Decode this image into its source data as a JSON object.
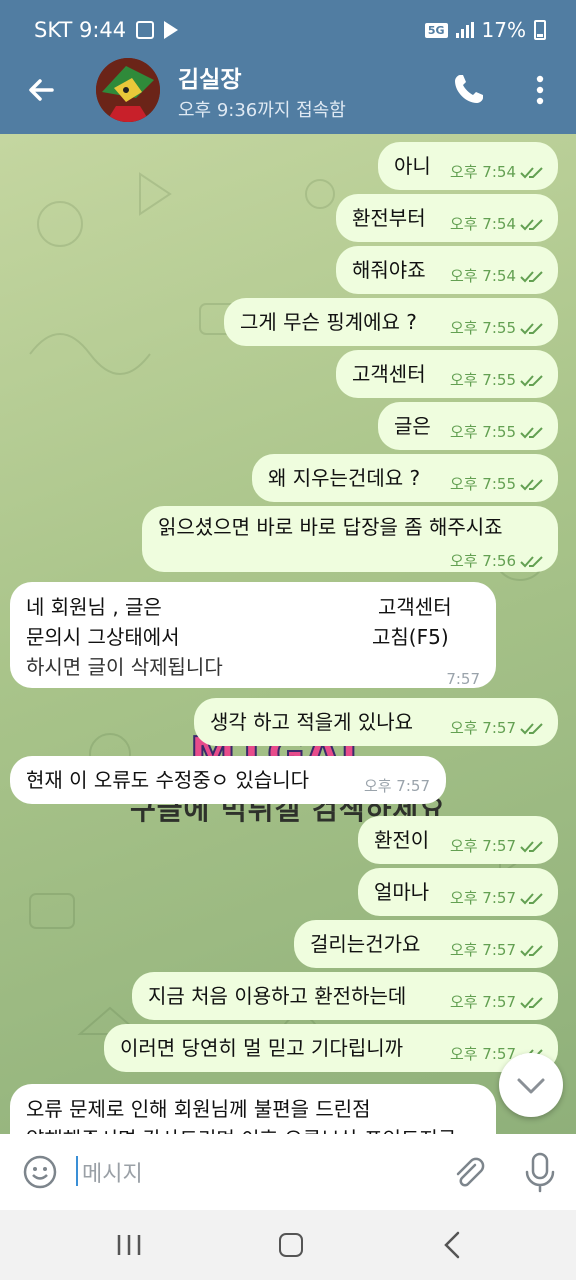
{
  "status_bar": {
    "carrier_time": "SKT 9:44",
    "network": "5G",
    "battery": "17%"
  },
  "header": {
    "title": "김실장",
    "subtitle": "오후 9:36까지 접속함"
  },
  "messages": [
    {
      "dir": "out",
      "text": "아니",
      "time": "오후 7:54"
    },
    {
      "dir": "out",
      "text": "환전부터",
      "time": "오후 7:54"
    },
    {
      "dir": "out",
      "text": "해줘야죠",
      "time": "오후 7:54"
    },
    {
      "dir": "out",
      "text": "그게 무슨 핑계에요 ?",
      "time": "오후 7:55"
    },
    {
      "dir": "out",
      "text": "고객센터",
      "time": "오후 7:55"
    },
    {
      "dir": "out",
      "text": "글은",
      "time": "오후 7:55"
    },
    {
      "dir": "out",
      "text": "왜 지우는건데요 ?",
      "time": "오후 7:55"
    },
    {
      "dir": "out",
      "text": "읽으셨으면 바로 바로 답장을 좀 해주시죠",
      "time": "오후 7:56"
    },
    {
      "dir": "in",
      "line1": "네 회원님 , 글은",
      "line1b": "고객센터",
      "line2": "문의시 그상태에서",
      "line2b": "고침(F5)",
      "line3": "하시면 글이 삭제됩니다",
      "time": "7:57"
    },
    {
      "dir": "out",
      "text": "생각 하고 적을게 있나요",
      "time": "오후 7:57"
    },
    {
      "dir": "in",
      "text": "현재 이 오류도 수정중ㅇ 있습니다",
      "time": "오후 7:57"
    },
    {
      "dir": "out",
      "text": "환전이",
      "time": "오후 7:57"
    },
    {
      "dir": "out",
      "text": "얼마나",
      "time": "오후 7:57"
    },
    {
      "dir": "out",
      "text": "걸리는건가요",
      "time": "오후 7:57"
    },
    {
      "dir": "out",
      "text": "지금 처음 이용하고 환전하는데",
      "time": "오후 7:57"
    },
    {
      "dir": "out",
      "text": "이러면 당연히 멀 믿고 기다립니까",
      "time": "오후 7:57"
    },
    {
      "dir": "in",
      "line1": "오류 문제로 인해 회원님께 불편을 드린점",
      "line2": "양해해주시면 감사드리며 이후 오류보상 포인트지급"
    }
  ],
  "watermark": {
    "logo": "MTGAL",
    "text": "구글에 먹튀갤 검색하세요"
  },
  "input": {
    "placeholder": "메시지"
  }
}
